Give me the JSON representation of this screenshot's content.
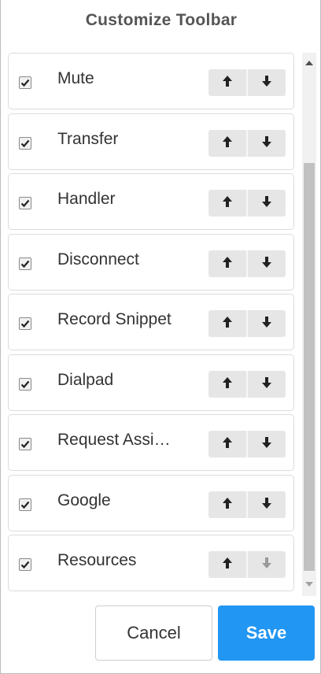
{
  "dialog": {
    "title": "Customize Toolbar"
  },
  "items": [
    {
      "label": "Mute",
      "checked": true,
      "up_enabled": true,
      "down_enabled": true
    },
    {
      "label": "Transfer",
      "checked": true,
      "up_enabled": true,
      "down_enabled": true
    },
    {
      "label": "Handler",
      "checked": true,
      "up_enabled": true,
      "down_enabled": true
    },
    {
      "label": "Disconnect",
      "checked": true,
      "up_enabled": true,
      "down_enabled": true
    },
    {
      "label": "Record Snippet",
      "checked": true,
      "up_enabled": true,
      "down_enabled": true
    },
    {
      "label": "Dialpad",
      "checked": true,
      "up_enabled": true,
      "down_enabled": true
    },
    {
      "label": "Request Assi…",
      "checked": true,
      "up_enabled": true,
      "down_enabled": true
    },
    {
      "label": "Google",
      "checked": true,
      "up_enabled": true,
      "down_enabled": true
    },
    {
      "label": "Resources",
      "checked": true,
      "up_enabled": true,
      "down_enabled": false
    }
  ],
  "footer": {
    "cancel_label": "Cancel",
    "save_label": "Save"
  },
  "colors": {
    "accent": "#2196f3",
    "button_bg": "#e6e6e6",
    "arrow_enabled": "#222222",
    "arrow_disabled": "#9a9a9a"
  },
  "icons": {
    "checkbox": "check-icon",
    "move_up": "arrow-up-icon",
    "move_down": "arrow-down-icon",
    "scroll_up": "scroll-up-arrow-icon",
    "scroll_down": "scroll-down-arrow-icon"
  }
}
